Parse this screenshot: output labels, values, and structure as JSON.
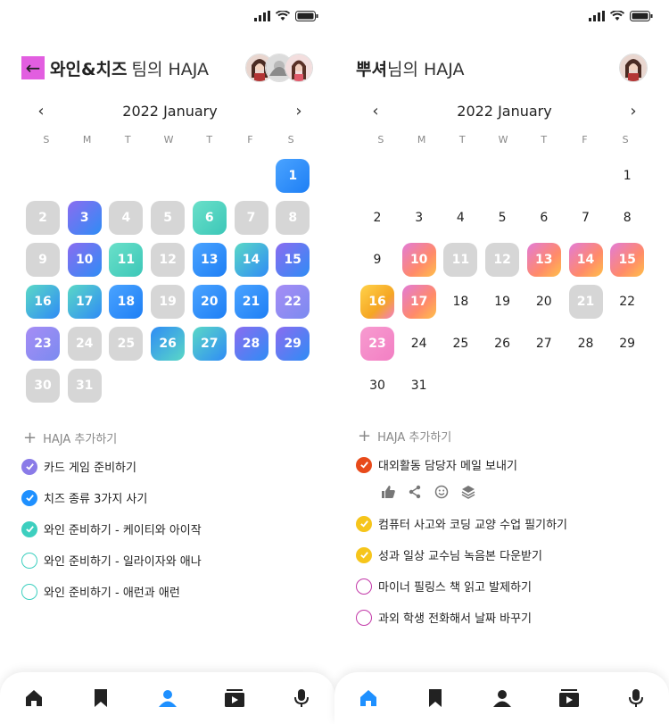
{
  "left": {
    "title_bold": "와인&치즈",
    "title_rest": "팀의 HAJA",
    "month": "2022 January",
    "weekdays": [
      "S",
      "M",
      "T",
      "W",
      "T",
      "F",
      "S"
    ],
    "add_label": "HAJA 추가하기",
    "todos": [
      {
        "text": "카드 게임 준비하기",
        "color": "#8a7be8",
        "done": true
      },
      {
        "text": "치즈 종류 3가지 사기",
        "color": "#1e90ff",
        "done": true
      },
      {
        "text": "와인 준비하기 - 케이티와 아이작",
        "color": "#3dcfbf",
        "done": true
      },
      {
        "text": "와인 준비하기 - 일라이자와 애나",
        "color": "#3dcfbf",
        "done": false
      },
      {
        "text": "와인 준비하기 - 애런과 애런",
        "color": "#3dcfbf",
        "done": false
      }
    ],
    "nav_active": "profile"
  },
  "right": {
    "title_bold": "뿌셔",
    "title_rest": "님의 HAJA",
    "month": "2022 January",
    "weekdays": [
      "S",
      "M",
      "T",
      "W",
      "T",
      "F",
      "S"
    ],
    "add_label": "HAJA 추가하기",
    "todos": [
      {
        "text": "대외활동 담당자 메일 보내기",
        "color": "#e84a1a",
        "done": true
      },
      {
        "text": "컴퓨터 사고와 코딩 교양 수업 필기하기",
        "color": "#f6c51b",
        "done": true
      },
      {
        "text": "성과 일상 교수님 녹음본 다운받기",
        "color": "#f6c51b",
        "done": true
      },
      {
        "text": "마이너 필링스 책 읽고 발제하기",
        "color": "#c238a8",
        "done": false
      },
      {
        "text": "과외 학생 전화해서 날짜 바꾸기",
        "color": "#c238a8",
        "done": false
      }
    ],
    "actions": [
      "thumbs-up-icon",
      "share-icon",
      "smile-icon",
      "layers-icon"
    ],
    "nav_active": "home"
  },
  "nav_items": [
    "home",
    "bookmark",
    "profile",
    "video",
    "mic"
  ],
  "colors": {
    "nav_active": "#1e90ff",
    "nav_inactive": "#222222"
  }
}
